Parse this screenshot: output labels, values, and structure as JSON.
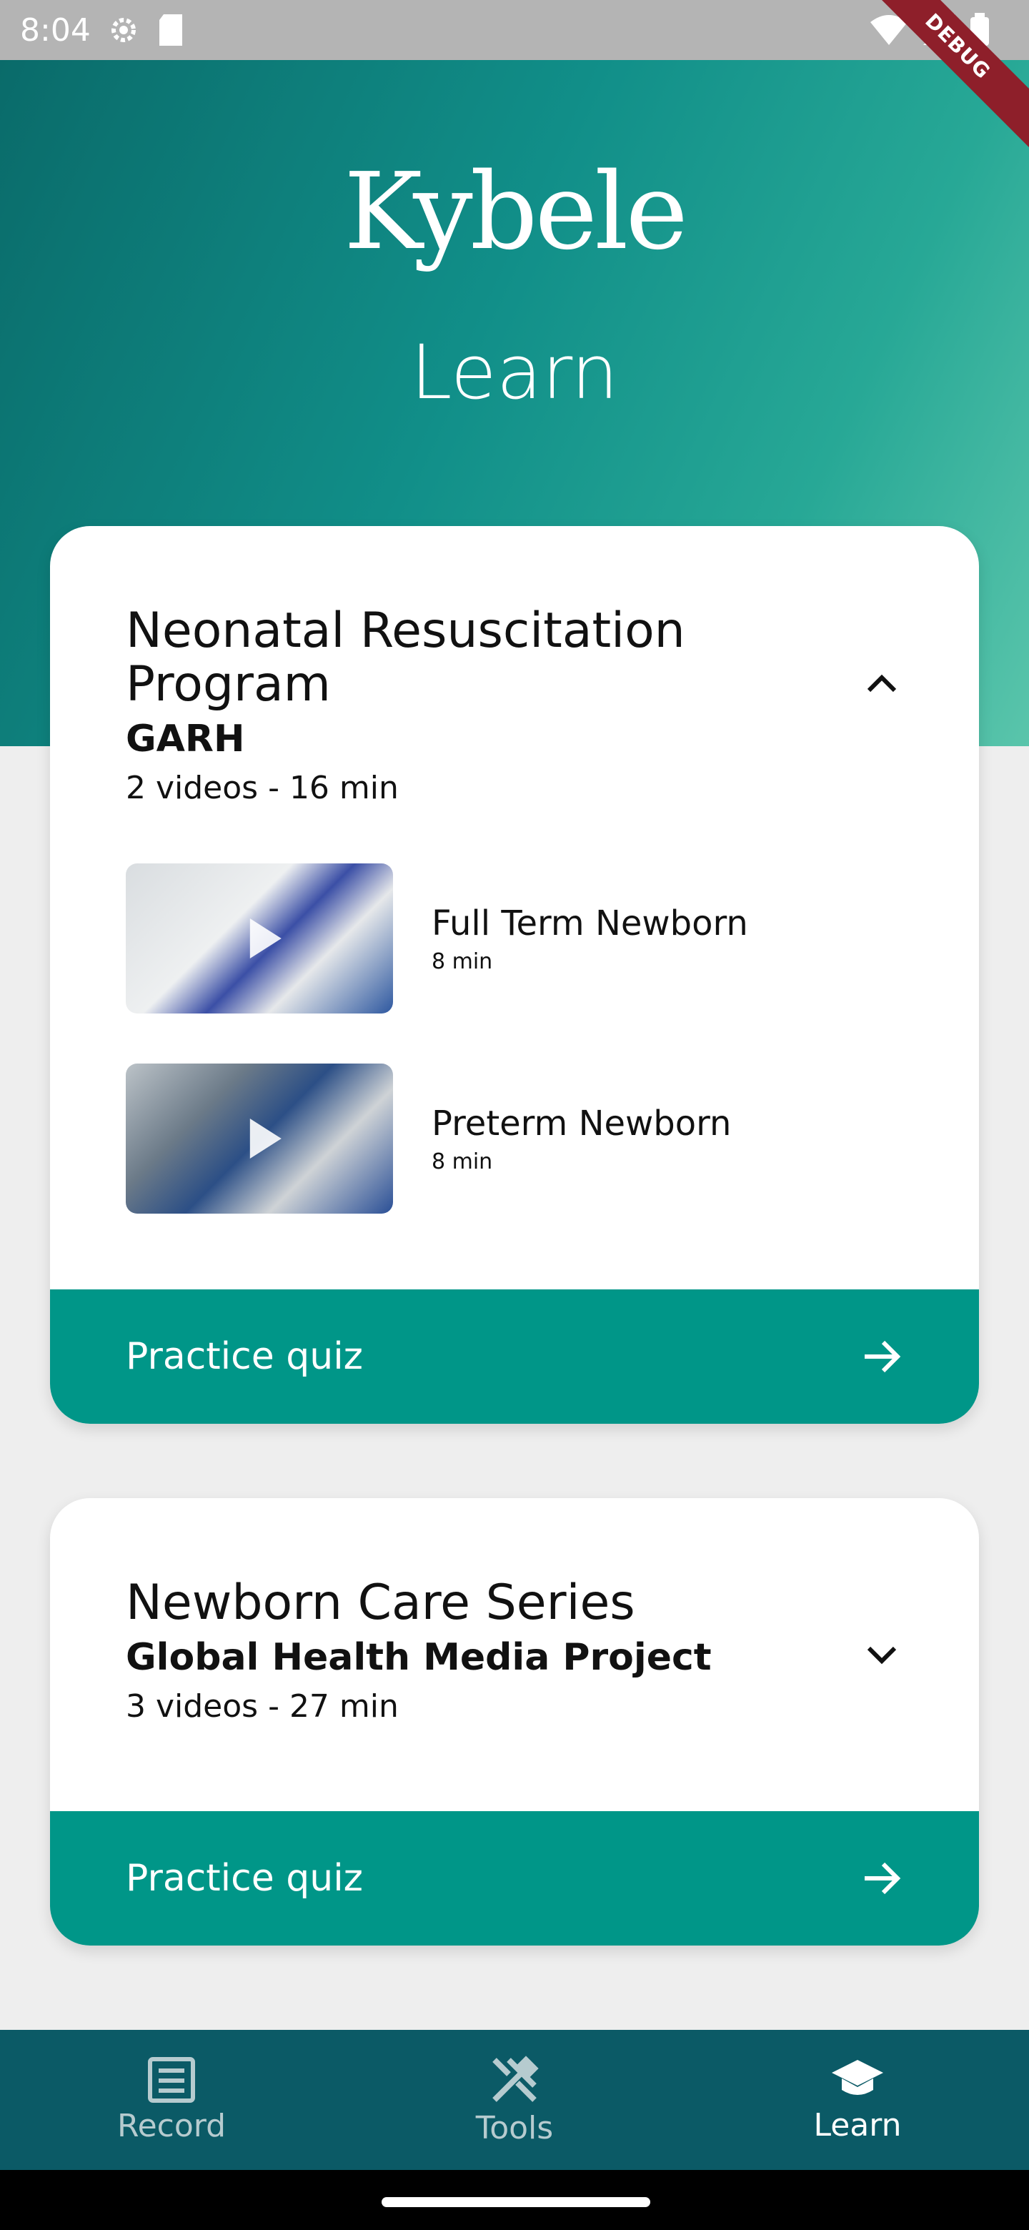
{
  "status_bar": {
    "time": "8:04"
  },
  "debug_banner": "DEBUG",
  "brand": {
    "logo_text": "Kybele"
  },
  "page": {
    "title": "Learn"
  },
  "courses": [
    {
      "title": "Neonatal Resuscitation Program",
      "source": "GARH",
      "meta": "2 videos - 16 min",
      "expanded": true,
      "videos": [
        {
          "title": "Full Term Newborn",
          "duration": "8 min"
        },
        {
          "title": "Preterm Newborn",
          "duration": "8 min"
        }
      ],
      "quiz_label": "Practice quiz"
    },
    {
      "title": "Newborn Care Series",
      "source": "Global Health Media Project",
      "meta": "3 videos - 27 min",
      "expanded": false,
      "quiz_label": "Practice quiz"
    }
  ],
  "nav": {
    "items": [
      {
        "label": "Record",
        "icon": "list-icon"
      },
      {
        "label": "Tools",
        "icon": "tools-icon"
      },
      {
        "label": "Learn",
        "icon": "graduation-cap-icon"
      }
    ],
    "active": "Learn"
  },
  "colors": {
    "accent": "#009688",
    "nav_bg": "#0b5a66",
    "hero_start": "#0a6b6a",
    "hero_end": "#5ac5ab"
  }
}
